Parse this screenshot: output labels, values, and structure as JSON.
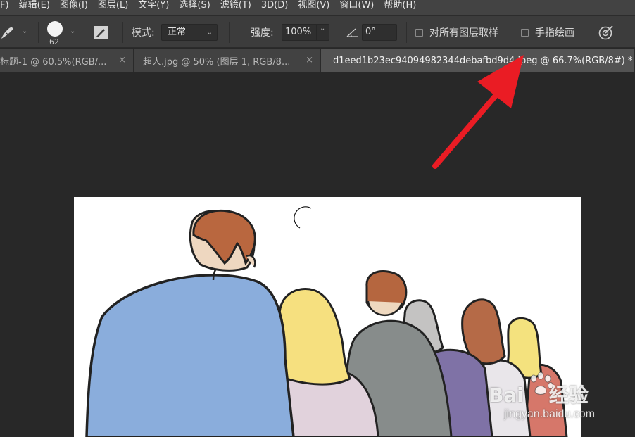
{
  "menu": {
    "items": [
      "F)",
      "编辑(E)",
      "图像(I)",
      "图层(L)",
      "文字(Y)",
      "选择(S)",
      "滤镜(T)",
      "3D(D)",
      "视图(V)",
      "窗口(W)",
      "帮助(H)"
    ]
  },
  "options": {
    "brush_size": "62",
    "mode_label": "模式:",
    "mode_value": "正常",
    "strength_label": "强度:",
    "strength_value": "100%",
    "angle_value": "0°",
    "sample_all_layers_label": "对所有图层取样",
    "finger_painting_label": "手指绘画"
  },
  "tabs": [
    {
      "label": "标题-1 @ 60.5%(RGB/...",
      "close": "×",
      "active": false
    },
    {
      "label": "超人.jpg @ 50% (图层 1, RGB/8...",
      "close": "×",
      "active": false
    },
    {
      "label": "d1eed1b23ec94094982344debafbd9d4.jpeg @ 66.7%(RGB/8#) *",
      "close": "",
      "active": true
    }
  ],
  "watermark": {
    "brand": "Bai",
    "brand_suffix": "经验",
    "url": "jingyan.baidu.com"
  },
  "annotation": {
    "arrow_color": "#ea1c24"
  },
  "colors": {
    "menubar_bg": "#434343",
    "options_bg": "#3c3c3c",
    "tab_active_bg": "#535353",
    "workspace_bg": "#282828"
  }
}
